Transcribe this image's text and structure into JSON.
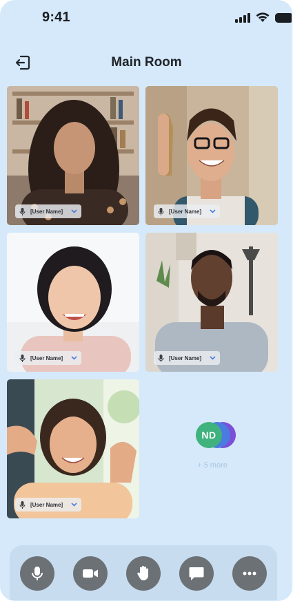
{
  "status_bar": {
    "time": "9:41"
  },
  "header": {
    "title": "Main Room"
  },
  "participants": [
    {
      "name": "[User Name]"
    },
    {
      "name": "[User Name]"
    },
    {
      "name": "[User Name]"
    },
    {
      "name": "[User Name]"
    },
    {
      "name": "[User Name]"
    }
  ],
  "overflow": {
    "initials": "ND",
    "more_label": "+ 5 more"
  },
  "toolbar": {
    "buttons": [
      "microphone-icon",
      "video-camera-icon",
      "raise-hand-icon",
      "chat-icon",
      "more-options-icon"
    ]
  },
  "colors": {
    "background": "#d5e9fb",
    "toolbar": "#c7dcef",
    "button": "#6c7176",
    "avatar_green": "#3fb27d",
    "avatar_blue": "#4b7be0",
    "avatar_purple": "#7b4fd8"
  }
}
